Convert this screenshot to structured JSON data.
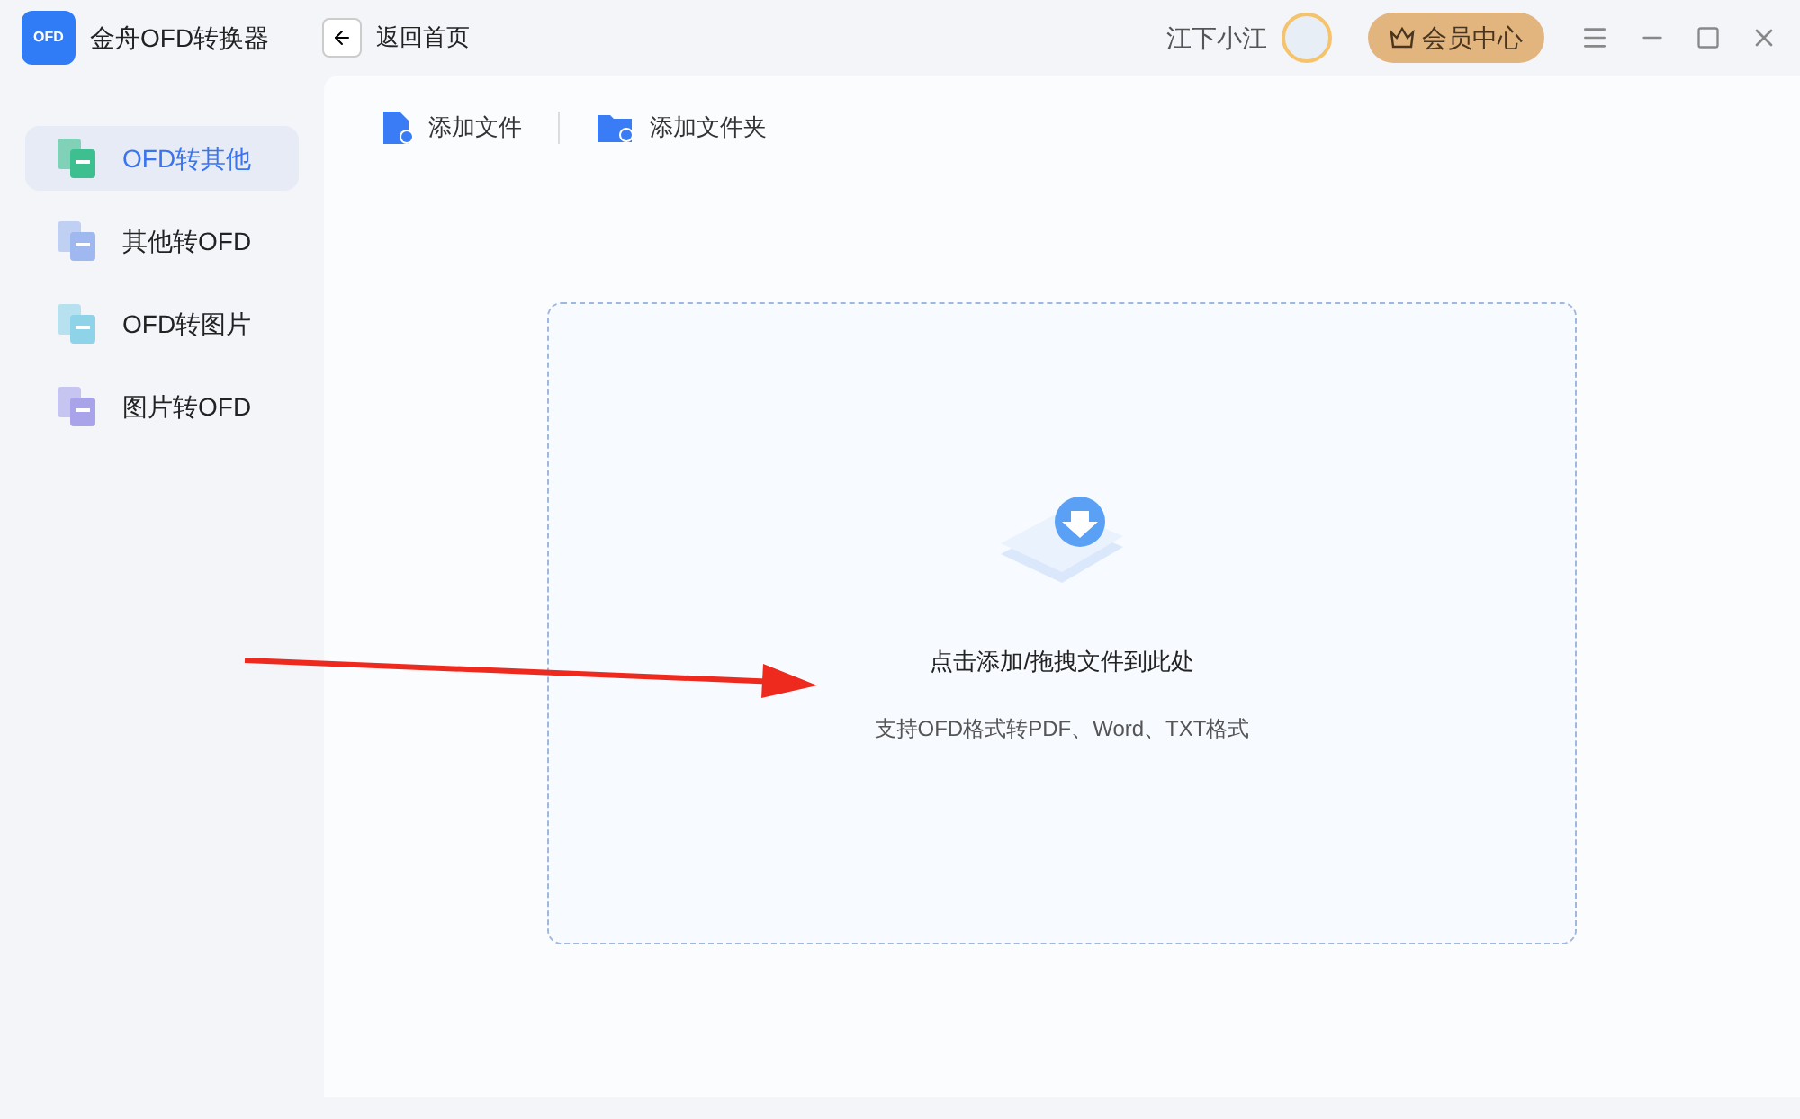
{
  "app": {
    "title": "金舟OFD转换器",
    "logo_text": "OFD"
  },
  "header": {
    "back_label": "返回首页",
    "username": "江下小江",
    "vip_label": "会员中心"
  },
  "sidebar": {
    "items": [
      {
        "label": "OFD转其他",
        "selected": true,
        "color": "#3dbf8f"
      },
      {
        "label": "其他转OFD",
        "selected": false,
        "color": "#9fb8ef"
      },
      {
        "label": "OFD转图片",
        "selected": false,
        "color": "#8fd3e8"
      },
      {
        "label": "图片转OFD",
        "selected": false,
        "color": "#a9a3ea"
      }
    ]
  },
  "toolbar": [
    {
      "kind": "file",
      "label": "添加文件"
    },
    {
      "kind": "folder",
      "label": "添加文件夹"
    }
  ],
  "dropzone": {
    "title": "点击添加/拖拽文件到此处",
    "hint": "支持OFD格式转PDF、Word、TXT格式"
  }
}
